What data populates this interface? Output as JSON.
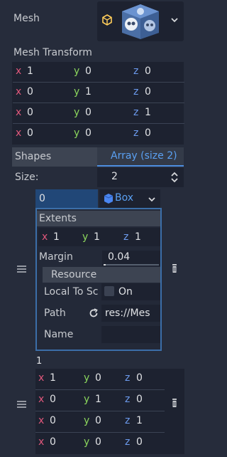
{
  "mesh": {
    "label": "Mesh"
  },
  "mesh_transform": {
    "label": "Mesh Transform",
    "rows": [
      {
        "x": "1",
        "y": "0",
        "z": "0"
      },
      {
        "x": "0",
        "y": "1",
        "z": "0"
      },
      {
        "x": "0",
        "y": "0",
        "z": "1"
      },
      {
        "x": "0",
        "y": "0",
        "z": "0"
      }
    ]
  },
  "shapes": {
    "label": "Shapes",
    "array_label": "Array (size 2)",
    "size_label": "Size:",
    "size_value": "2"
  },
  "item0": {
    "index": "0",
    "type_label": "Box",
    "extents_label": "Extents",
    "extents": {
      "x": "1",
      "y": "1",
      "z": "1"
    },
    "margin_label": "Margin",
    "margin_value": "0.04",
    "margin_fraction": 0.04,
    "resource_label": "Resource",
    "local_to_scene_label": "Local To Sc",
    "local_to_scene_value": "On",
    "path_label": "Path",
    "path_value": "res://Mes",
    "name_label": "Name",
    "name_value": ""
  },
  "item1": {
    "index": "1",
    "rows": [
      {
        "x": "1",
        "y": "0",
        "z": "0"
      },
      {
        "x": "0",
        "y": "1",
        "z": "0"
      },
      {
        "x": "0",
        "y": "0",
        "z": "1"
      },
      {
        "x": "0",
        "y": "0",
        "z": "0"
      }
    ]
  },
  "axes": {
    "x": "x",
    "y": "y",
    "z": "z"
  },
  "icons": {
    "resource_icon": "cube-icon",
    "preview": "godot-cube-preview",
    "dropdown": "chevron-down-icon",
    "reset": "reload-icon",
    "drag": "drag-handle-icon",
    "delete": "trash-icon"
  },
  "colors": {
    "background": "#262c3b",
    "field": "#1d2230",
    "accent": "#4e8fe0",
    "axis_x": "#e0577b",
    "axis_y": "#8bd65d",
    "axis_z": "#6d9cf0"
  }
}
